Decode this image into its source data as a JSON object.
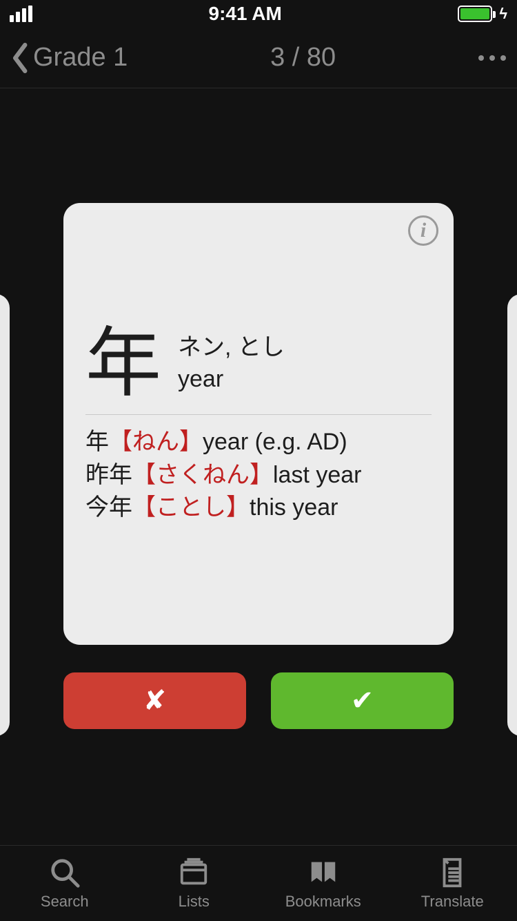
{
  "status": {
    "time": "9:41 AM"
  },
  "nav": {
    "back_label": "Grade 1",
    "progress": "3 / 80"
  },
  "card": {
    "kanji": "年",
    "readings": "ネン, とし",
    "meaning": "year",
    "examples": [
      {
        "word": "年",
        "reading": "ねん",
        "meaning": "year (e.g. AD)"
      },
      {
        "word": "昨年",
        "reading": "さくねん",
        "meaning": "last year"
      },
      {
        "word": "今年",
        "reading": "ことし",
        "meaning": "this year"
      }
    ]
  },
  "icons": {
    "info": "i",
    "wrong": "✘",
    "correct": "✔"
  },
  "tabs": {
    "search": "Search",
    "lists": "Lists",
    "bookmarks": "Bookmarks",
    "translate": "Translate"
  }
}
